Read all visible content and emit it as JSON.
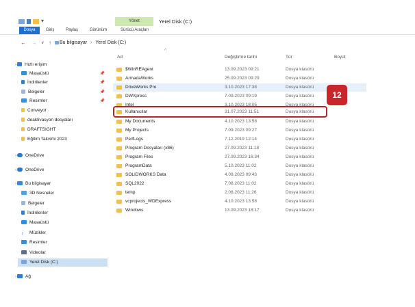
{
  "window": {
    "title": "Yerel Disk (C:)",
    "context_tab": "Yönet",
    "context_subtab": "Sürücü Araçları"
  },
  "ribbon": {
    "tabs": [
      "Dosya",
      "Giriş",
      "Paylaş",
      "Görünüm"
    ]
  },
  "address": {
    "crumbs": [
      "Bu bilgisayar",
      "Yerel Disk (C:)"
    ],
    "separator": "›"
  },
  "columns": {
    "name": "Ad",
    "date": "Değiştirme tarihi",
    "type": "Tür",
    "size": "Boyut"
  },
  "sidebar": {
    "quick_access": "Hızlı erişim",
    "quick_items": [
      "Masaüstü",
      "İndirilenler",
      "Belgeler",
      "Resimler",
      "Conveyor",
      "deaktivasyon dosyaları",
      "DRAFTSIGHT",
      "Eğitim Takvimi 2023"
    ],
    "onedrive1": "OneDrive",
    "onedrive2": "OneDrive",
    "this_pc": "Bu bilgisayar",
    "pc_items": [
      "3D Nesneler",
      "Belgeler",
      "İndirilenler",
      "Masaüstü",
      "Müzikler",
      "Resimler",
      "Videolar",
      "Yerel Disk (C:)"
    ],
    "network": "Ağ"
  },
  "files": [
    {
      "name": "$WinREAgent",
      "date": "13.09.2023 09:21",
      "type": "Dosya klasörü"
    },
    {
      "name": "ArmadaWorks",
      "date": "25.09.2023 09:29",
      "type": "Dosya klasörü"
    },
    {
      "name": "DriveWorks Pro",
      "date": "3.10.2023 17:38",
      "type": "Dosya klasörü"
    },
    {
      "name": "DWXpress",
      "date": "7.09.2023 09:19",
      "type": "Dosya klasörü"
    },
    {
      "name": "Intel",
      "date": "3.10.2023 18:05",
      "type": "Dosya klasörü"
    },
    {
      "name": "Kullanıcılar",
      "date": "31.07.2023 11:51",
      "type": "Dosya klasörü"
    },
    {
      "name": "My Documents",
      "date": "4.10.2023 13:58",
      "type": "Dosya klasörü"
    },
    {
      "name": "My Projects",
      "date": "7.09.2023 09:27",
      "type": "Dosya klasörü"
    },
    {
      "name": "PerfLogs",
      "date": "7.12.2019 12:14",
      "type": "Dosya klasörü"
    },
    {
      "name": "Program Dosyaları (x86)",
      "date": "27.09.2023 11:18",
      "type": "Dosya klasörü"
    },
    {
      "name": "Program Files",
      "date": "27.09.2023 16:34",
      "type": "Dosya klasörü"
    },
    {
      "name": "ProgramData",
      "date": "5.10.2023 11:02",
      "type": "Dosya klasörü"
    },
    {
      "name": "SOLIDWORKS Data",
      "date": "4.09.2023 09:43",
      "type": "Dosya klasörü"
    },
    {
      "name": "SQL2022",
      "date": "7.08.2023 11:02",
      "type": "Dosya klasörü"
    },
    {
      "name": "temp",
      "date": "2.08.2023 11:26",
      "type": "Dosya klasörü"
    },
    {
      "name": "vcprojects_WDExpress",
      "date": "4.10.2023 13:58",
      "type": "Dosya klasörü"
    },
    {
      "name": "Windows",
      "date": "13.09.2023 18:17",
      "type": "Dosya klasörü"
    }
  ],
  "badge": {
    "text": "12"
  },
  "colors": {
    "accent": "#1e6fd0",
    "highlight": "#b3262c",
    "folder": "#f3c04a",
    "selected": "#cce0f4"
  }
}
